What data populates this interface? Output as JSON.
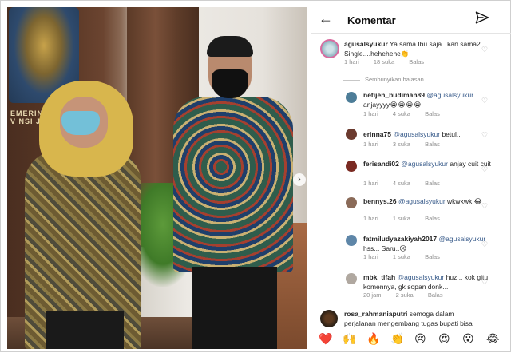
{
  "photo": {
    "banner_text": "EMERINT\nV NSI JAN"
  },
  "header": {
    "back_icon": "arrow-left-icon",
    "title": "Komentar",
    "send_icon": "paper-plane-icon"
  },
  "comments": [
    {
      "username": "agusalsyukur",
      "text": "Ya sama Ibu saja.. kan sama2 Single....hehehehe👏",
      "time": "1 hari",
      "likes": "18 suka",
      "reply": "Balas"
    }
  ],
  "hide_replies": "Sembunyikan balasan",
  "replies": [
    {
      "username": "netijen_budiman89",
      "mention": "@agusalsyukur",
      "text": "anjayyyy😭😭😭😭",
      "time": "1 hari",
      "likes": "4 suka",
      "reply": "Balas"
    },
    {
      "username": "erinna75",
      "mention": "@agusalsyukur",
      "text": "betul..",
      "time": "1 hari",
      "likes": "3 suka",
      "reply": "Balas"
    },
    {
      "username": "ferisandi02",
      "mention": "@agusalsyukur",
      "text": "anjay cuit cuit",
      "time": "1 hari",
      "likes": "4 suka",
      "reply": "Balas"
    },
    {
      "username": "bennys.26",
      "mention": "@agusalsyukur",
      "text": "wkwkwk 😂",
      "time": "1 hari",
      "likes": "1 suka",
      "reply": "Balas"
    },
    {
      "username": "fatmiludyazakiyah2017",
      "mention": "@agusalsyukur",
      "text": "hss... Saru..😥",
      "time": "1 hari",
      "likes": "1 suka",
      "reply": "Balas"
    },
    {
      "username": "mbk_tifah",
      "mention": "@agusalsyukur",
      "text": "huz... kok gitu komennya, gk sopan donk...",
      "time": "20 jam",
      "likes": "2 suka",
      "reply": "Balas"
    }
  ],
  "last_comment": {
    "username": "rosa_rahmaniaputri",
    "text": "semoga dalam perjalanan mengembang tugas bupati bisa"
  },
  "emoji_bar": [
    "❤️",
    "🙌",
    "🔥",
    "👏",
    "😢",
    "😍",
    "😮",
    "😂"
  ],
  "colors": {
    "mention": "#375a8a",
    "meta": "#8e8e8e"
  }
}
